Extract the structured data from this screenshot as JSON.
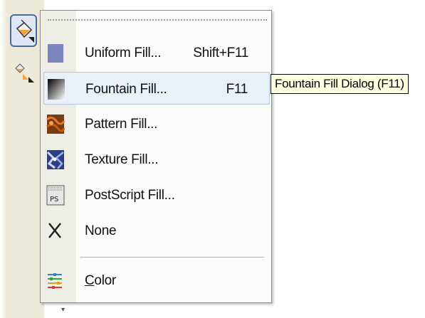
{
  "menu": {
    "items": [
      {
        "label": "Uniform Fill...",
        "shortcut": "Shift+F11",
        "icon": "uniform-fill-icon"
      },
      {
        "label": "Fountain Fill...",
        "shortcut": "F11",
        "icon": "fountain-fill-icon"
      },
      {
        "label": "Pattern Fill...",
        "shortcut": "",
        "icon": "pattern-fill-icon"
      },
      {
        "label": "Texture Fill...",
        "shortcut": "",
        "icon": "texture-fill-icon"
      },
      {
        "label": "PostScript Fill...",
        "shortcut": "",
        "icon": "postscript-fill-icon"
      },
      {
        "label": "None",
        "shortcut": "",
        "icon": "none-icon"
      }
    ],
    "color_item": {
      "label_first": "C",
      "label_rest": "olor",
      "icon": "color-icon"
    },
    "highlighted_index": 1,
    "postscript_icon_text": "PS"
  },
  "tooltip": {
    "text": "Fountain Fill Dialog (F11)"
  },
  "colors": {
    "uniform_swatch": "#7d85bf",
    "highlight_bg": "#eaf0f8",
    "tooltip_bg": "#ffffe1",
    "tool_active_border": "#4a6b9b"
  }
}
